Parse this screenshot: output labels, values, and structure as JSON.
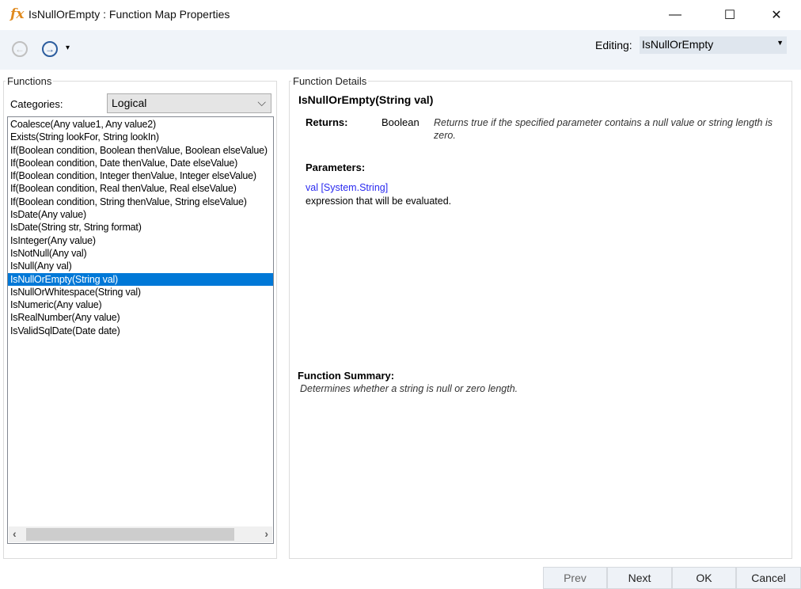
{
  "window": {
    "title": "IsNullOrEmpty : Function Map Properties",
    "icon": "fx-icon",
    "minimize": "—",
    "maximize": "☐",
    "close": "✕"
  },
  "toolbar": {
    "back": "←",
    "forward": "→",
    "dropdown": "▾",
    "editing_label": "Editing:",
    "editing_value": "IsNullOrEmpty"
  },
  "functions": {
    "legend": "Functions",
    "categories_label": "Categories:",
    "category": "Logical",
    "items": [
      "Coalesce(Any value1, Any value2)",
      "Exists(String lookFor, String lookIn)",
      "If(Boolean condition, Boolean thenValue, Boolean elseValue)",
      "If(Boolean condition, Date thenValue, Date elseValue)",
      "If(Boolean condition, Integer thenValue, Integer elseValue)",
      "If(Boolean condition, Real thenValue, Real elseValue)",
      "If(Boolean condition, String thenValue, String elseValue)",
      "IsDate(Any value)",
      "IsDate(String str, String format)",
      "IsInteger(Any value)",
      "IsNotNull(Any val)",
      "IsNull(Any val)",
      "IsNullOrEmpty(String val)",
      "IsNullOrWhitespace(String val)",
      "IsNumeric(Any value)",
      "IsRealNumber(Any value)",
      "IsValidSqlDate(Date date)"
    ],
    "selected_index": 12
  },
  "details": {
    "legend": "Function Details",
    "signature": "IsNullOrEmpty(String val)",
    "returns_label": "Returns:",
    "returns_type": "Boolean",
    "returns_desc": "Returns true if the specified parameter contains a null value or string length is zero.",
    "parameters_label": "Parameters:",
    "param_name": "val [System.String]",
    "param_desc": "expression that will be evaluated.",
    "summary_label": "Function Summary:",
    "summary": "Determines whether a string is null or zero length."
  },
  "buttons": {
    "prev": "Prev",
    "next": "Next",
    "ok": "OK",
    "cancel": "Cancel"
  }
}
